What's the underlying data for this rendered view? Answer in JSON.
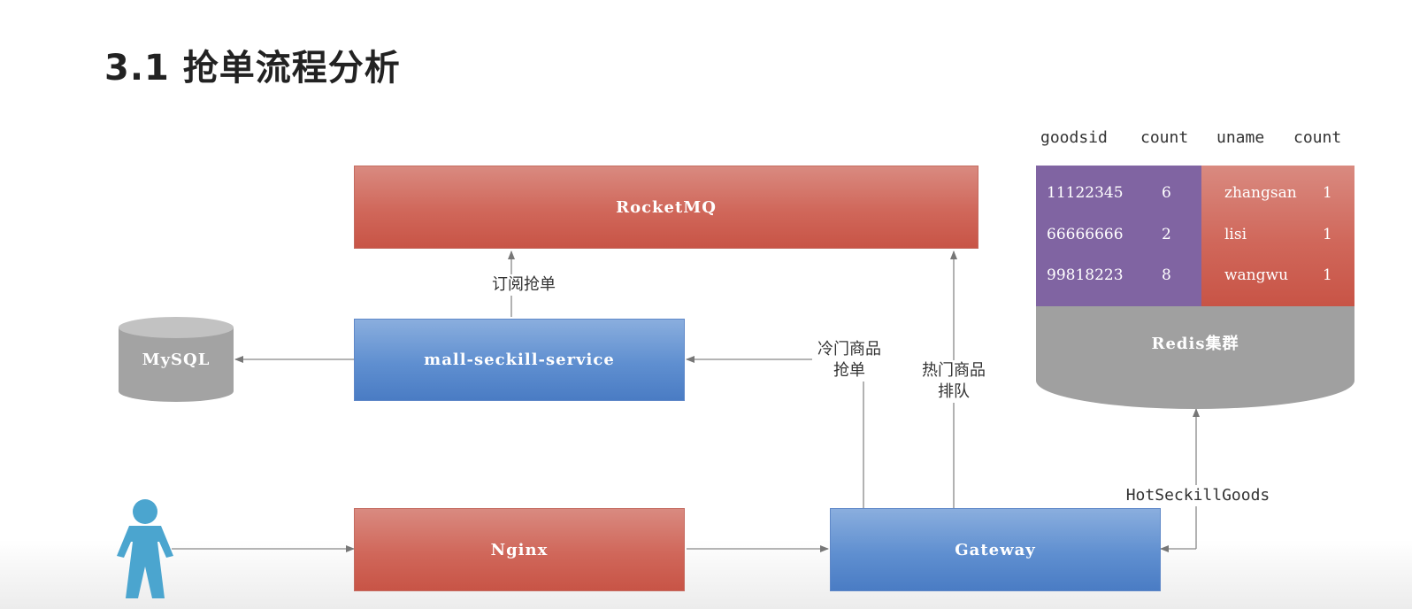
{
  "title": "3.1 抢单流程分析",
  "nodes": {
    "rocketmq": "RocketMQ",
    "seckill_service": "mall-seckill-service",
    "mysql": "MySQL",
    "nginx": "Nginx",
    "gateway": "Gateway",
    "redis": "Redis集群"
  },
  "edge_labels": {
    "subscribe": "订阅抢单",
    "cold_line1": "冷门商品",
    "cold_line2": "抢单",
    "hot_line1": "热门商品",
    "hot_line2": "排队",
    "hot_seckill": "HotSeckillGoods"
  },
  "redis_table": {
    "headers": [
      "goodsid",
      "count",
      "uname",
      "count"
    ],
    "left_rows": [
      {
        "goodsid": "11122345",
        "count": "6"
      },
      {
        "goodsid": "66666666",
        "count": "2"
      },
      {
        "goodsid": "99818223",
        "count": "8"
      }
    ],
    "right_rows": [
      {
        "uname": "zhangsan",
        "count": "1"
      },
      {
        "uname": "lisi",
        "count": "1"
      },
      {
        "uname": "wangwu",
        "count": "1"
      }
    ]
  },
  "colors": {
    "red_box": "#d0675a",
    "blue_box": "#5f8fd0",
    "purple_cell": "#8064a2",
    "gray_db": "#a6a6a6",
    "user_icon": "#4ba5cf"
  }
}
